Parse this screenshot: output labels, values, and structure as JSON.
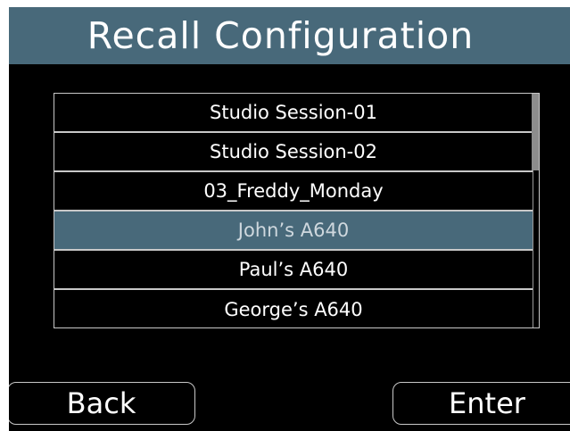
{
  "header": {
    "title": "Recall Configuration"
  },
  "config_list": {
    "items": [
      {
        "label": "Studio Session-01",
        "selected": false
      },
      {
        "label": "Studio Session-02",
        "selected": false
      },
      {
        "label": "03_Freddy_Monday",
        "selected": false
      },
      {
        "label": "John’s A640",
        "selected": true
      },
      {
        "label": "Paul’s A640",
        "selected": false
      },
      {
        "label": "George’s A640",
        "selected": false
      }
    ]
  },
  "footer": {
    "back_label": "Back",
    "enter_label": "Enter"
  },
  "colors": {
    "title_bar": "#48697a",
    "selected_row": "#48697a",
    "background": "#000000",
    "border": "#c8c8c8"
  }
}
